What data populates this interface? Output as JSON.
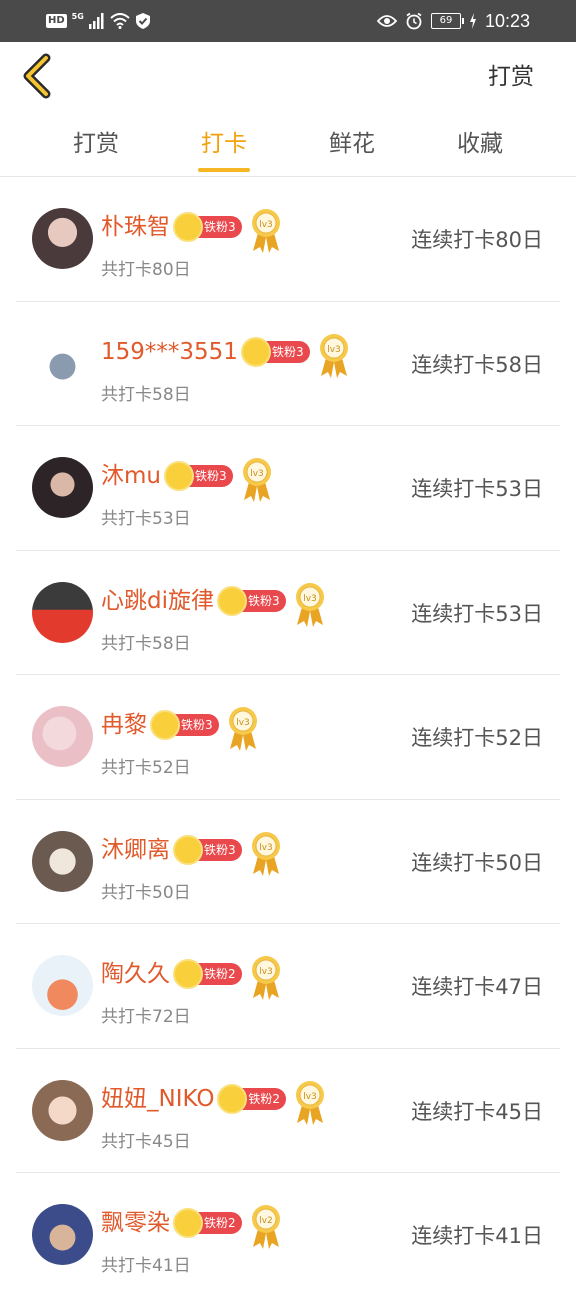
{
  "status_bar": {
    "hd": "HD",
    "network": "5G",
    "battery": "69",
    "time": "10:23",
    "icons": [
      "signal-icon",
      "wifi-icon",
      "shield-icon",
      "eye-icon",
      "alarm-icon",
      "charging-icon"
    ]
  },
  "header": {
    "back_icon": "chevron-left-icon",
    "action_label": "打赏"
  },
  "tabs": [
    {
      "label": "打赏",
      "active": false
    },
    {
      "label": "打卡",
      "active": true
    },
    {
      "label": "鲜花",
      "active": false
    },
    {
      "label": "收藏",
      "active": false
    }
  ],
  "colors": {
    "accent": "#f2a20c",
    "name": "#e05a2b",
    "badge": "#e9484c",
    "status_bar": "#4a4a4a"
  },
  "rows": [
    {
      "name": "朴珠智",
      "badge": "铁粉3",
      "level": "lv3",
      "total": "共打卡80日",
      "streak": "连续打卡80日"
    },
    {
      "name": "159***3551",
      "badge": "铁粉3",
      "level": "lv3",
      "total": "共打卡58日",
      "streak": "连续打卡58日"
    },
    {
      "name": "沐mu",
      "badge": "铁粉3",
      "level": "lv3",
      "total": "共打卡53日",
      "streak": "连续打卡53日"
    },
    {
      "name": "心跳di旋律",
      "badge": "铁粉3",
      "level": "lv3",
      "total": "共打卡58日",
      "streak": "连续打卡53日"
    },
    {
      "name": "冉黎",
      "badge": "铁粉3",
      "level": "lv3",
      "total": "共打卡52日",
      "streak": "连续打卡52日"
    },
    {
      "name": "沐卿离",
      "badge": "铁粉3",
      "level": "lv3",
      "total": "共打卡50日",
      "streak": "连续打卡50日"
    },
    {
      "name": "陶久久",
      "badge": "铁粉2",
      "level": "lv3",
      "total": "共打卡72日",
      "streak": "连续打卡47日"
    },
    {
      "name": "妞妞_NIKO",
      "badge": "铁粉2",
      "level": "lv3",
      "total": "共打卡45日",
      "streak": "连续打卡45日"
    },
    {
      "name": "飘零染",
      "badge": "铁粉2",
      "level": "lv2",
      "total": "共打卡41日",
      "streak": "连续打卡41日"
    }
  ]
}
